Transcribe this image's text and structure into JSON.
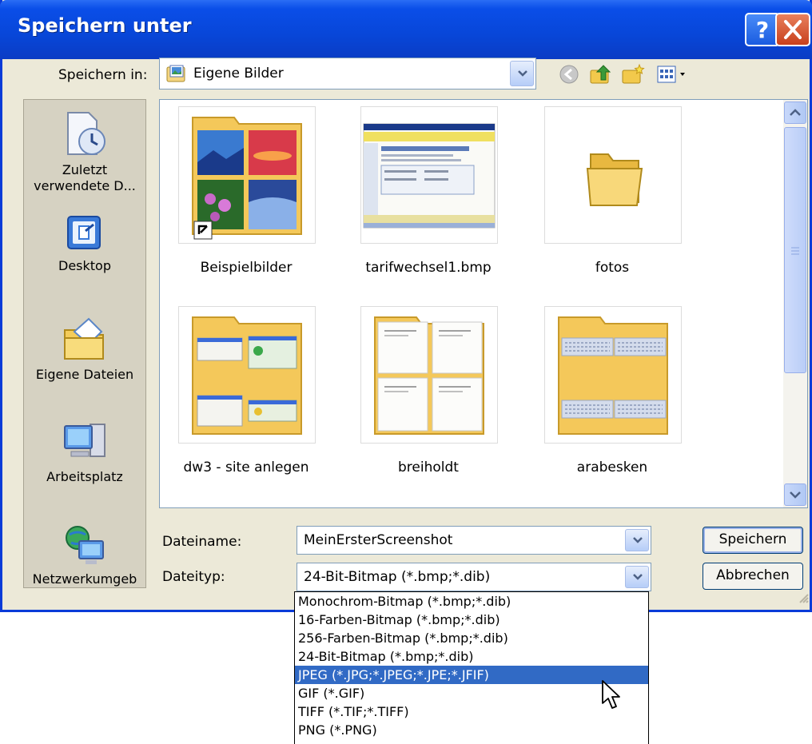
{
  "window": {
    "title": "Speichern unter"
  },
  "toolbar": {
    "lookin_label": "Speichern in:",
    "lookin_value": "Eigene Bilder"
  },
  "places": [
    {
      "label": "Zuletzt verwendete D...",
      "icon": "recent-documents-icon"
    },
    {
      "label": "Desktop",
      "icon": "desktop-icon"
    },
    {
      "label": "Eigene Dateien",
      "icon": "my-documents-icon"
    },
    {
      "label": "Arbeitsplatz",
      "icon": "my-computer-icon"
    },
    {
      "label": "Netzwerkumgeb",
      "icon": "network-places-icon"
    }
  ],
  "files": [
    {
      "name": "Beispielbilder",
      "kind": "folder-shortcut"
    },
    {
      "name": "tarifwechsel1.bmp",
      "kind": "bitmap"
    },
    {
      "name": "fotos",
      "kind": "folder"
    },
    {
      "name": "dw3 - site anlegen",
      "kind": "folder"
    },
    {
      "name": "breiholdt",
      "kind": "folder"
    },
    {
      "name": "arabesken",
      "kind": "folder"
    }
  ],
  "form": {
    "filename_label": "Dateiname:",
    "filename_value": "MeinErsterScreenshot",
    "filetype_label": "Dateityp:",
    "filetype_value": "24-Bit-Bitmap (*.bmp;*.dib)",
    "save_label": "Speichern",
    "cancel_label": "Abbrechen"
  },
  "filetype_options": [
    "Monochrom-Bitmap (*.bmp;*.dib)",
    "16-Farben-Bitmap (*.bmp;*.dib)",
    "256-Farben-Bitmap (*.bmp;*.dib)",
    "24-Bit-Bitmap (*.bmp;*.dib)",
    "JPEG (*.JPG;*.JPEG;*.JPE;*.JFIF)",
    "GIF (*.GIF)",
    "TIFF (*.TIF;*.TIFF)",
    "PNG (*.PNG)"
  ],
  "selected_option_index": 4,
  "colors": {
    "titlebar": "#0846d8",
    "selection": "#316ac5",
    "dialog": "#ece9d8"
  }
}
